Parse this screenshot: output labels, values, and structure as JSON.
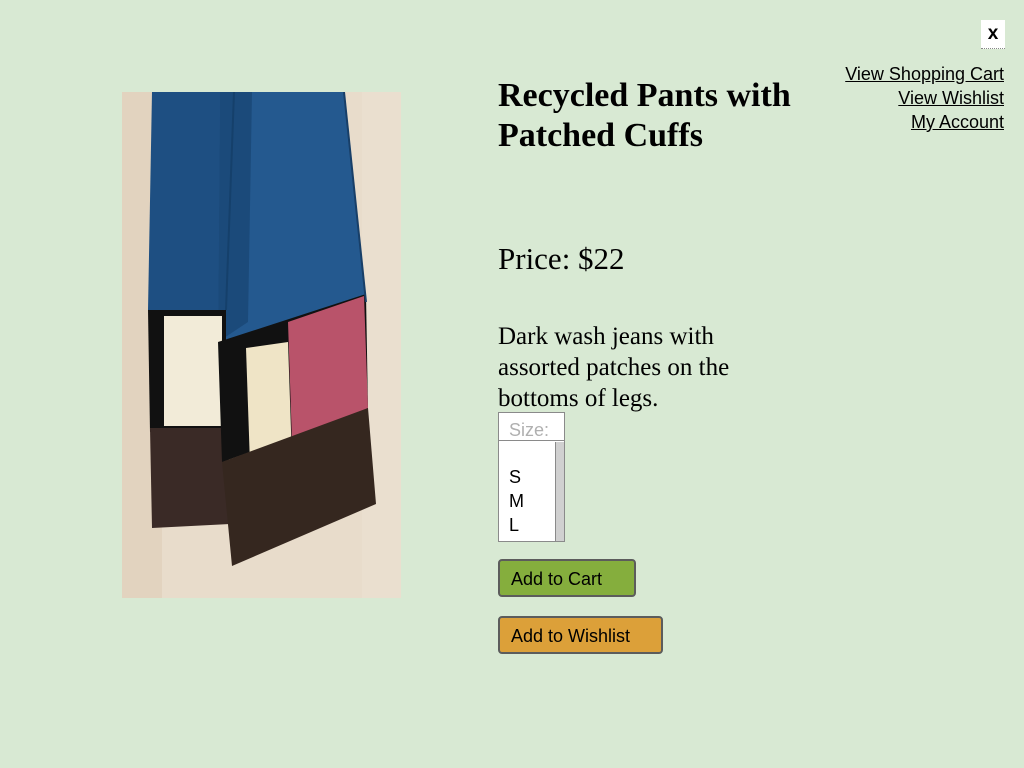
{
  "window": {
    "close_label": "x"
  },
  "nav": {
    "links": [
      {
        "label": "View Shopping Cart"
      },
      {
        "label": "View Wishlist"
      },
      {
        "label": "My Account"
      }
    ]
  },
  "product": {
    "title": "Recycled Pants with Patched Cuffs",
    "price": "Price: $22",
    "description": "Dark wash jeans with assorted patches on the bottoms of legs.",
    "image_alt": "product-photo"
  },
  "size_select": {
    "placeholder": "Size:",
    "options": [
      "S",
      "M",
      "L"
    ]
  },
  "actions": {
    "add_to_cart": "Add to Cart",
    "add_to_wishlist": "Add to Wishlist"
  },
  "colors": {
    "background": "#d8e9d3",
    "add_to_cart_bg": "#85ae3d",
    "add_to_wishlist_bg": "#dca039"
  }
}
